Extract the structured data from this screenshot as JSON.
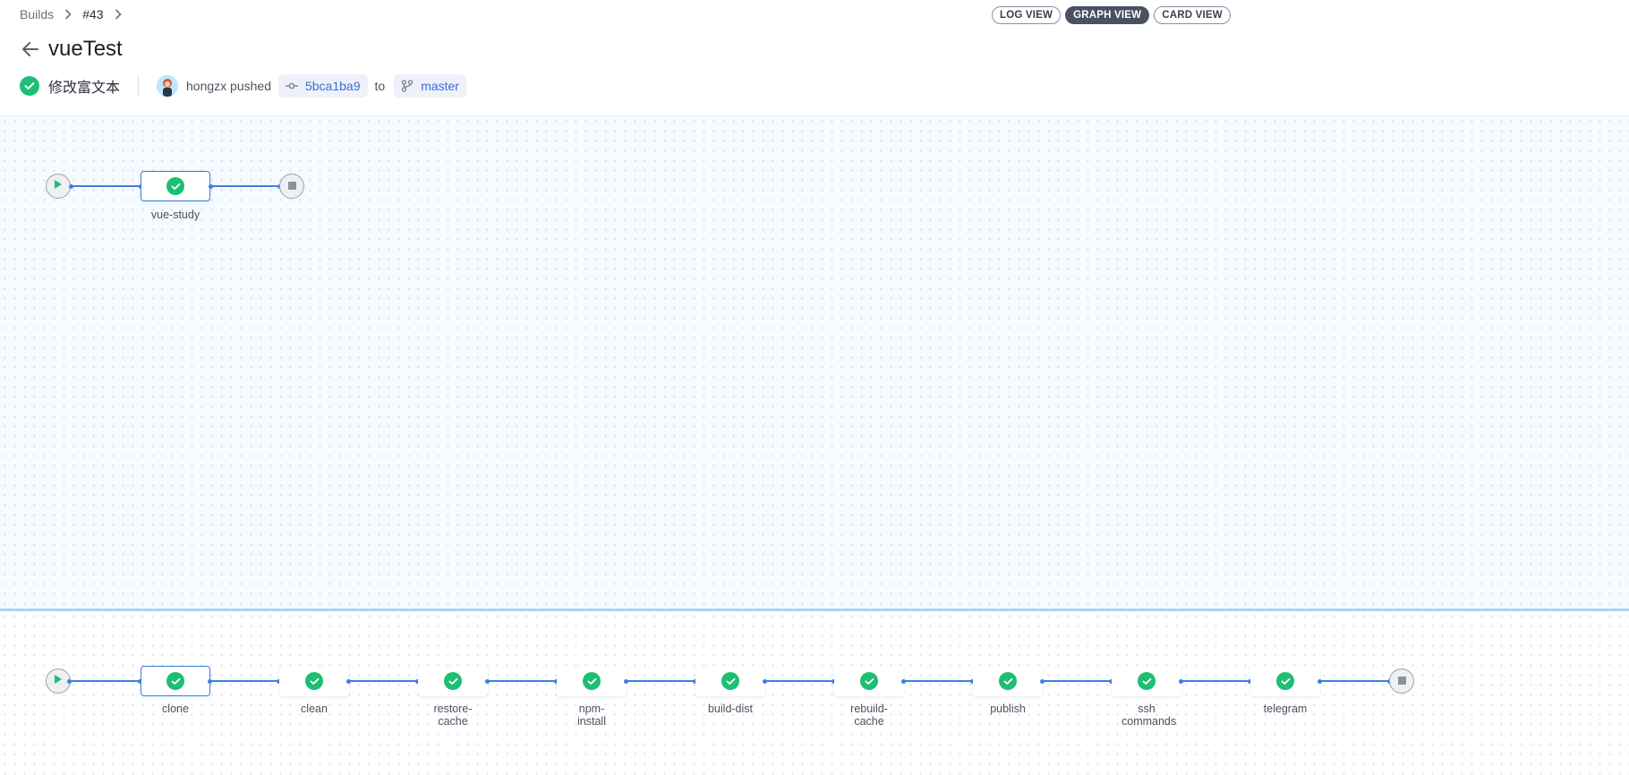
{
  "breadcrumb": {
    "root": "Builds",
    "build": "#43"
  },
  "header": {
    "title": "vueTest",
    "commit_message": "修改富文本",
    "author_action": "hongzx pushed",
    "commit_sha": "5bca1ba9",
    "to_word": "to",
    "branch": "master"
  },
  "views": {
    "log": "LOG VIEW",
    "graph": "GRAPH VIEW",
    "card": "CARD VIEW",
    "active": "GRAPH VIEW"
  },
  "stages_graph": {
    "stages": [
      {
        "label": "vue-study",
        "status": "success"
      }
    ]
  },
  "steps_graph": {
    "steps": [
      {
        "label": "clone",
        "status": "success"
      },
      {
        "label": "clean",
        "status": "success"
      },
      {
        "label": "restore-cache",
        "status": "success"
      },
      {
        "label": "npm-install",
        "status": "success"
      },
      {
        "label": "build-dist",
        "status": "success"
      },
      {
        "label": "rebuild-cache",
        "status": "success"
      },
      {
        "label": "publish",
        "status": "success"
      },
      {
        "label": "ssh commands",
        "status": "success"
      },
      {
        "label": "telegram",
        "status": "success"
      }
    ]
  },
  "colors": {
    "success": "#1dbf73",
    "edge": "#3f7fe0",
    "active_view": "#4b5063",
    "splitter": "#a8d4f6"
  },
  "icons": [
    "chevron-right-icon",
    "back-arrow-icon",
    "check-circle-icon",
    "commit-icon",
    "branch-icon",
    "play-icon",
    "stop-icon"
  ]
}
